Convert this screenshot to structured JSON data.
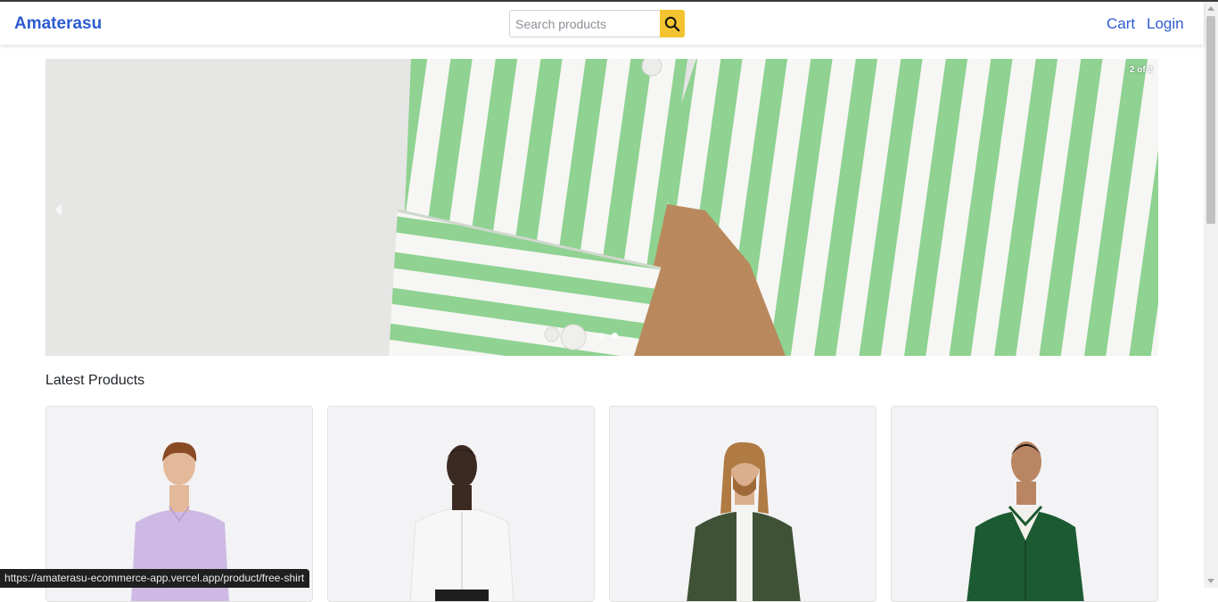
{
  "header": {
    "brand": "Amaterasu",
    "search": {
      "placeholder": "Search products",
      "value": ""
    },
    "nav": {
      "cart": "Cart",
      "login": "Login"
    }
  },
  "carousel": {
    "counter": "2 of 2",
    "slides": 2,
    "active_slide": 2
  },
  "latest": {
    "title": "Latest Products"
  },
  "products": [
    {
      "shirt_color": "#cdb9e3",
      "skin": "#e3b99a",
      "hair": "#8a4a24"
    },
    {
      "shirt_color": "#f7f7f7",
      "skin": "#3b2a22",
      "hair": "#161210"
    },
    {
      "shirt_color": "#3f5236",
      "skin": "#dbae8d",
      "hair": "#b07a43"
    },
    {
      "shirt_color": "#1c5a32",
      "skin": "#b98563",
      "hair": "#1a1412"
    }
  ],
  "status_bar": {
    "url": "https://amaterasu-ecommerce-app.vercel.app/product/free-shirt"
  },
  "colors": {
    "brand": "#2d5bd0",
    "search_button": "#f4c430",
    "stripe_green": "#8fd291"
  },
  "icons": {
    "search": "search-icon"
  }
}
